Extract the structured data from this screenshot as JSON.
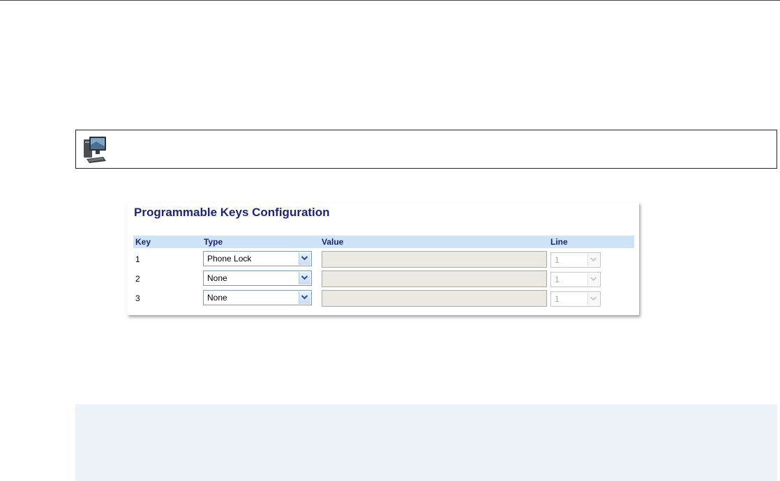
{
  "note": {
    "icon": "computer-icon"
  },
  "panel": {
    "title": "Programmable Keys Configuration",
    "columns": {
      "key": "Key",
      "type": "Type",
      "value": "Value",
      "line": "Line"
    },
    "rows": [
      {
        "key": "1",
        "type": "Phone Lock",
        "value": "",
        "line": "1"
      },
      {
        "key": "2",
        "type": "None",
        "value": "",
        "line": "1"
      },
      {
        "key": "3",
        "type": "None",
        "value": "",
        "line": "1"
      }
    ]
  },
  "colors": {
    "title": "#1c2474",
    "header_bg": "#cfe3f7",
    "disabled_input": "#ece9e3",
    "bottom_band": "#edf2f9"
  }
}
